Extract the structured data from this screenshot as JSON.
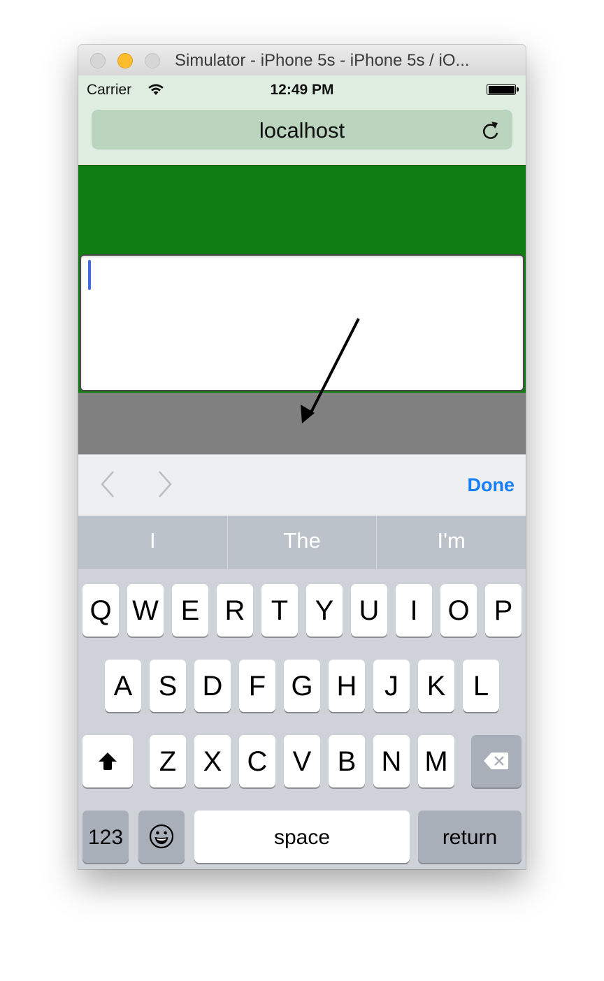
{
  "window": {
    "title": "Simulator - iPhone 5s - iPhone 5s / iO..."
  },
  "status_bar": {
    "carrier": "Carrier",
    "time": "12:49 PM",
    "battery_level": 1.0
  },
  "browser": {
    "url": "localhost",
    "reload_icon": "reload-icon"
  },
  "page": {
    "textarea_value": "",
    "header_color": "#0f7d12",
    "footer_color": "#808080"
  },
  "accessory_bar": {
    "prev_icon": "chevron-left-icon",
    "next_icon": "chevron-right-icon",
    "done_label": "Done",
    "done_color": "#147efb"
  },
  "suggestions": [
    "I",
    "The",
    "I'm"
  ],
  "keyboard": {
    "row1": [
      "Q",
      "W",
      "E",
      "R",
      "T",
      "Y",
      "U",
      "I",
      "O",
      "P"
    ],
    "row2": [
      "A",
      "S",
      "D",
      "F",
      "G",
      "H",
      "J",
      "K",
      "L"
    ],
    "row3": [
      "Z",
      "X",
      "C",
      "V",
      "B",
      "N",
      "M"
    ],
    "numbers_label": "123",
    "space_label": "space",
    "return_label": "return",
    "shift_icon": "shift-icon",
    "delete_icon": "backspace-icon",
    "emoji_icon": "emoji-icon"
  }
}
